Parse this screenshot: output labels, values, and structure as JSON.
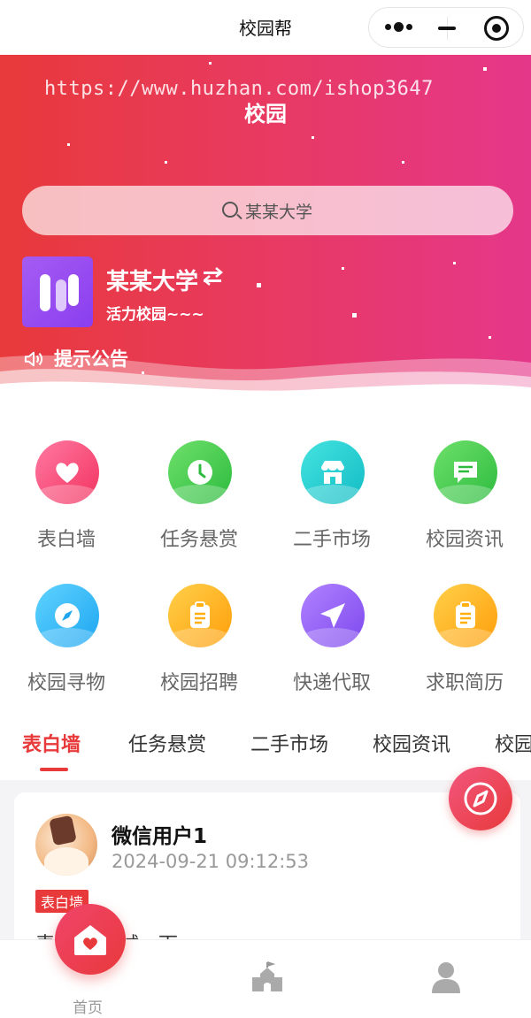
{
  "navbar": {
    "title": "校园帮"
  },
  "hero": {
    "watermark": "https://www.huzhan.com/ishop3647",
    "title": "校园",
    "search_placeholder": "某某大学",
    "school_name": "某某大学",
    "school_tagline": "活力校园~~~",
    "notice": "提示公告"
  },
  "grid": [
    {
      "label": "表白墙",
      "icon": "heart-icon",
      "color": "#f24a7a"
    },
    {
      "label": "任务悬赏",
      "icon": "clock-icon",
      "color": "#3cc74b"
    },
    {
      "label": "二手市场",
      "icon": "shop-icon",
      "color": "#1cc7c9"
    },
    {
      "label": "校园资讯",
      "icon": "message-icon",
      "color": "#39c64b"
    },
    {
      "label": "校园寻物",
      "icon": "compass-icon",
      "color": "#2fb6f5"
    },
    {
      "label": "校园招聘",
      "icon": "clipboard-icon",
      "color": "#ffb010"
    },
    {
      "label": "快递代取",
      "icon": "send-icon",
      "color": "#8f5cf2"
    },
    {
      "label": "求职简历",
      "icon": "clipboard-icon",
      "color": "#ffb010"
    }
  ],
  "tabs": [
    "表白墙",
    "任务悬赏",
    "二手市场",
    "校园资讯",
    "校园"
  ],
  "post": {
    "user_name": "微信用户1",
    "time": "2024-09-21 09:12:53",
    "badge": "表白墙",
    "content": "表白墙 测试一下"
  },
  "tabbar": {
    "home_label": "首页"
  },
  "colors": {
    "accent": "#e8393b",
    "hero_end": "#e5378a"
  }
}
